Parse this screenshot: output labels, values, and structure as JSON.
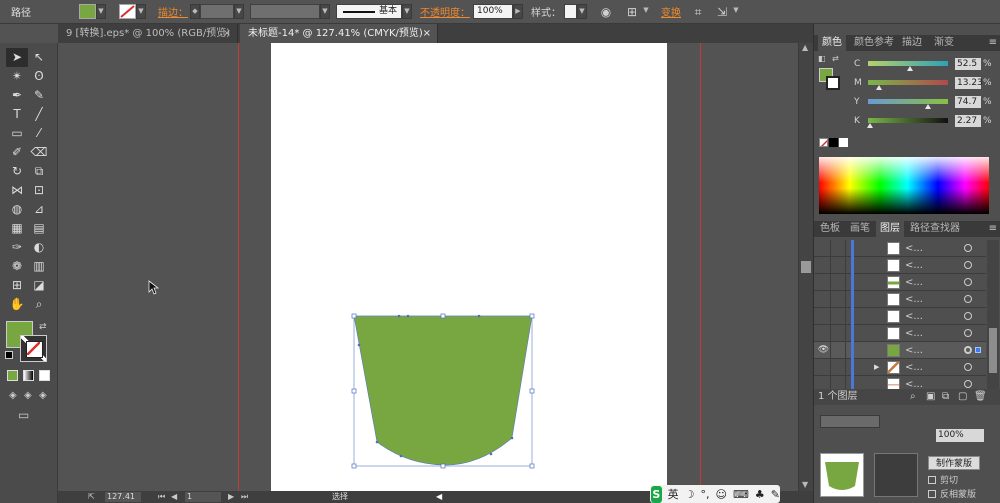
{
  "control_bar": {
    "title": "路径",
    "stroke_label": "描边：",
    "brush_label": "基本",
    "opacity_label": "不透明度：",
    "opacity_value": "100%",
    "style_label": "样式：",
    "transform_label": "变换",
    "fill_color": "#78a640"
  },
  "tabs": [
    {
      "label": "9 [转换].eps* @ 100% (RGB/预览)",
      "close": "×"
    },
    {
      "label": "未标题-14* @ 127.41% (CMYK/预览)",
      "close": "×"
    }
  ],
  "status": {
    "zoom": "127.41",
    "page": "1",
    "text": "选择"
  },
  "color_panel": {
    "tabs": [
      "颜色",
      "颜色参考",
      "描边",
      "渐变"
    ],
    "active_tab": "颜色",
    "fill_color": "#78a640",
    "channels": [
      {
        "label": "C",
        "value": "52.5",
        "fraction": 0.525,
        "unit": "%"
      },
      {
        "label": "M",
        "value": "13.23",
        "fraction": 0.1323,
        "unit": "%"
      },
      {
        "label": "Y",
        "value": "74.7",
        "fraction": 0.747,
        "unit": "%"
      },
      {
        "label": "K",
        "value": "2.27",
        "fraction": 0.0227,
        "unit": "%"
      }
    ]
  },
  "layers_panel": {
    "tabs": [
      "色板",
      "画笔",
      "图层",
      "路径查找器"
    ],
    "active_tab": "图层",
    "row_name": "<...",
    "footer": "1 个图层"
  },
  "transparency_panel": {
    "opacity": "100%",
    "make_mask": "制作蒙版",
    "clip": "剪切",
    "invert_mask": "反相蒙版"
  },
  "ime": {
    "logo": "S",
    "lang": "英"
  }
}
